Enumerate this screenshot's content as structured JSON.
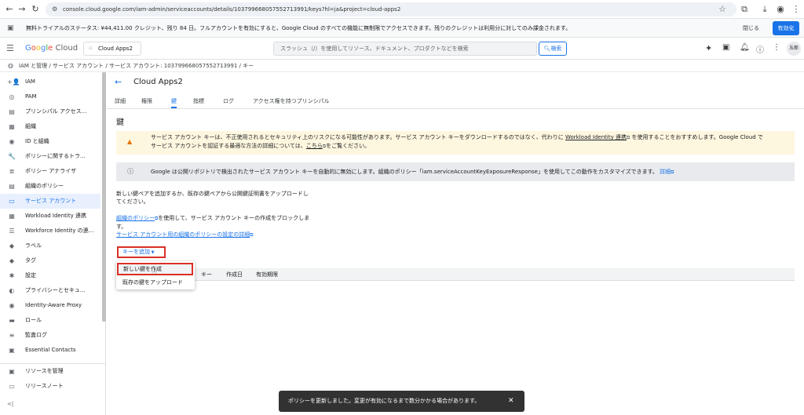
{
  "browser": {
    "url": "console.cloud.google.com/iam-admin/serviceaccounts/details/103799668057552713991/keys?hl=ja&project=cloud-apps2"
  },
  "trial_banner": {
    "text": "無料トライアルのステータス: ¥44,411.00 クレジット、残り 84 日。フルアカウントを有効にすると、Google Cloud のすべての機能に無制限でアクセスできます。残りのクレジットは利用分に対してのみ課金されます。",
    "dismiss_label": "閉じる",
    "activate_label": "有効化"
  },
  "header": {
    "logo_text": "Google Cloud",
    "project_name": "Cloud Apps2",
    "search_placeholder": "スラッシュ（/）を使用してリソース、ドキュメント、プロダクトなどを検索",
    "search_button": "検索",
    "avatar_text": "五郎"
  },
  "breadcrumb": "IAM と管理 / サービス アカウント / サービス アカウント: 103799668057552713991 / キー",
  "sidebar": {
    "items": [
      {
        "label": "IAM",
        "icon": "+👤"
      },
      {
        "label": "PAM",
        "icon": "◎"
      },
      {
        "label": "プリンシパル アクセス...",
        "icon": "▤"
      },
      {
        "label": "組織",
        "icon": "▦"
      },
      {
        "label": "ID と組織",
        "icon": "◉"
      },
      {
        "label": "ポリシーに関するトラ...",
        "icon": "🔧"
      },
      {
        "label": "ポリシー アナライザ",
        "icon": "≣"
      },
      {
        "label": "組織のポリシー",
        "icon": "▤"
      },
      {
        "label": "サービス アカウント",
        "icon": "▭"
      },
      {
        "label": "Workload Identity 連携",
        "icon": "▦"
      },
      {
        "label": "Workforce Identity の連...",
        "icon": "☰"
      },
      {
        "label": "ラベル",
        "icon": "◆"
      },
      {
        "label": "タグ",
        "icon": "◆"
      },
      {
        "label": "設定",
        "icon": "✱"
      },
      {
        "label": "プライバシーとセキュ...",
        "icon": "◐"
      },
      {
        "label": "Identity-Aware Proxy",
        "icon": "◉"
      },
      {
        "label": "ロール",
        "icon": "▬"
      },
      {
        "label": "監査ログ",
        "icon": "≡"
      },
      {
        "label": "Essential Contacts",
        "icon": "▣"
      }
    ],
    "manage_resources": "リソースを管理",
    "release_notes": "リリースノート",
    "collapse": "<|"
  },
  "page": {
    "title": "Cloud Apps2",
    "tabs": [
      "詳細",
      "権限",
      "鍵",
      "指標",
      "ログ",
      "アクセス権を持つプリンシパル"
    ],
    "active_tab": 2,
    "section_title": "鍵",
    "warning_pre": "サービス アカウント キーは、不正使用されるとセキュリティ上のリスクになる可能性があります。サービス アカウント キーをダウンロードするのではなく、代わりに ",
    "warning_link1": "Workload Identity 連携",
    "warning_mid": " を使用することをおすすめします。Google Cloud で",
    "warning_line2_pre": "サービス アカウントを認証する最適な方法の詳細については、",
    "warning_link2": "こちら",
    "warning_line2_post": "をご覧ください。",
    "info_text": "Google は公開リポジトリで検出されたサービス アカウント キーを自動的に無効にします。組織のポリシー「iam.serviceAccountKeyExposureResponse」を使用してこの動作をカスタマイズできます。",
    "info_link": "詳細",
    "desc_line1": "新しい鍵ペアを追加するか、既存の鍵ペアから公開鍵証明書をアップロードし",
    "desc_line2": "てください。",
    "policy_link": "組織のポリシー",
    "policy_text": "を使用して、サービス アカウント キーの作成をブロックしま",
    "policy_text2": "す。",
    "policy_detail_link": "サービス アカウント用の組織のポリシーの設定の詳細",
    "add_key_button": "キーを追加",
    "table_headers": [
      "キー",
      "作成日",
      "有効期限"
    ],
    "dropdown_items": [
      "新しい鍵を作成",
      "既存の鍵をアップロード"
    ]
  },
  "snackbar": {
    "text": "ポリシーを更新しました。変更が有効になるまで数分かかる場合があります。",
    "close": "✕"
  }
}
